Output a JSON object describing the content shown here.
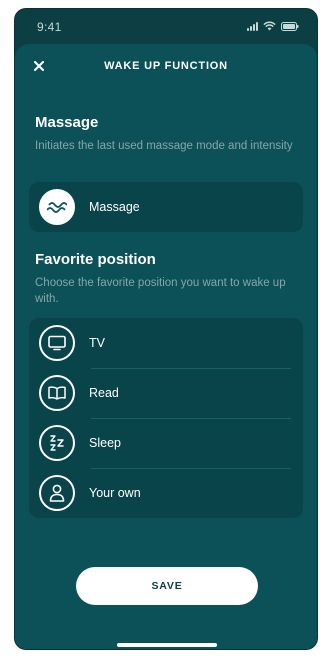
{
  "status": {
    "time": "9:41"
  },
  "header": {
    "title": "WAKE UP FUNCTION",
    "close_label": "×"
  },
  "massage": {
    "title": "Massage",
    "description": "Initiates the last used massage mode and intensity",
    "item_label": "Massage"
  },
  "favorite": {
    "title": "Favorite position",
    "description": "Choose the favorite position you want to wake up with.",
    "items": [
      {
        "label": "TV",
        "icon": "tv-icon"
      },
      {
        "label": "Read",
        "icon": "book-icon"
      },
      {
        "label": "Sleep",
        "icon": "sleep-icon"
      },
      {
        "label": "Your own",
        "icon": "person-icon"
      }
    ]
  },
  "actions": {
    "save_label": "SAVE"
  },
  "colors": {
    "background": "#0c5058",
    "card": "#0a444b",
    "accent": "#ffffff"
  }
}
